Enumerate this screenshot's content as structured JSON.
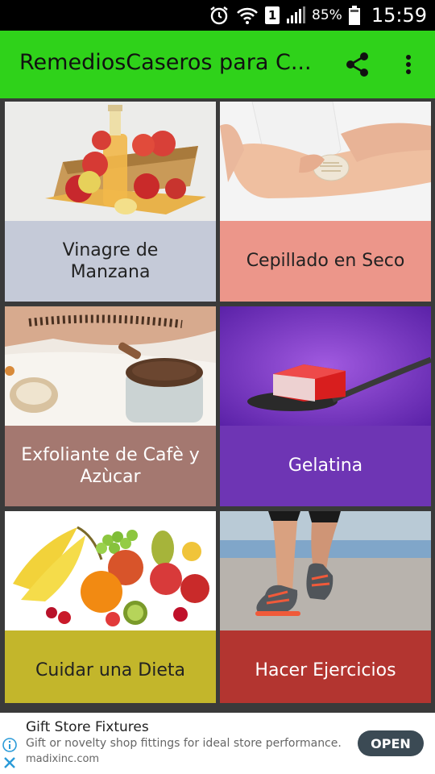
{
  "status_bar": {
    "battery_percent": "85%",
    "time": "15:59",
    "sim_label": "1",
    "icons": [
      "alarm-icon",
      "wifi-icon",
      "sim-icon",
      "signal-icon",
      "battery-icon"
    ]
  },
  "app_bar": {
    "title": "RemediosCaseros para C...",
    "background_color": "#2fd21a",
    "actions": [
      "share-icon",
      "more-vert-icon"
    ]
  },
  "remedies": [
    {
      "label": "Vinagre de Manzana",
      "image": "apples-and-vinegar-bottle",
      "color": "#c5cad8",
      "text_color": "#222222"
    },
    {
      "label": "Cepillado en Seco",
      "image": "dry-brushing-leg",
      "color": "#ec968a",
      "text_color": "#222222"
    },
    {
      "label": "Exfoliante de Cafè y Azùcar",
      "image": "coffee-sugar-scrub-jar",
      "color": "#a47870",
      "text_color": "#ffffff"
    },
    {
      "label": "Gelatina",
      "image": "red-gelatin-on-spoon",
      "color": "#6e35b4",
      "text_color": "#ffffff"
    },
    {
      "label": "Cuidar una Dieta",
      "image": "fresh-fruits-pile",
      "color": "#c3b62b",
      "text_color": "#222222"
    },
    {
      "label": "Hacer Ejercicios",
      "image": "running-legs",
      "color": "#b33530",
      "text_color": "#ffffff"
    }
  ],
  "ad": {
    "title": "Gift Store Fixtures",
    "description": "Gift or novelty shop fittings for ideal store performance.",
    "url": "madixinc.com",
    "button_label": "OPEN"
  }
}
